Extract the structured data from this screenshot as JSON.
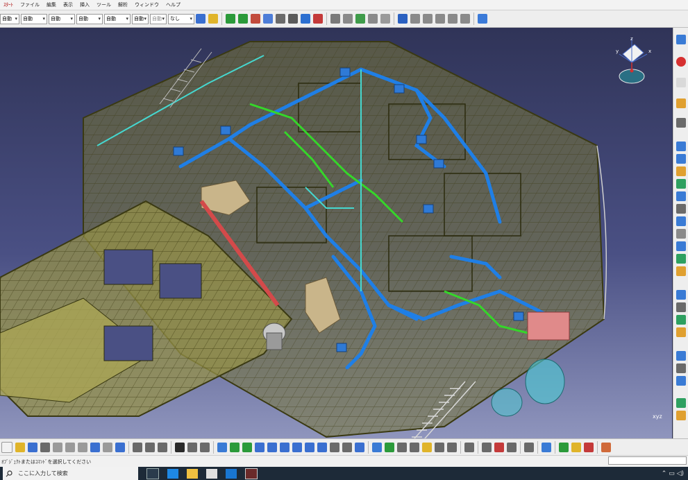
{
  "menubar": {
    "items": [
      "ｽﾀｰﾄ",
      "ファイル",
      "編集",
      "表示",
      "挿入",
      "ツール",
      "解析",
      "ウィンドウ",
      "ヘルプ"
    ]
  },
  "toolbar": {
    "selects": [
      "自動",
      "自動",
      "自動",
      "自動",
      "自動",
      "自動",
      "自動",
      "なし"
    ]
  },
  "compass": {
    "axis_x": "x",
    "axis_y": "y",
    "axis_z": "z"
  },
  "corner_axis": {
    "label": "xyz"
  },
  "status": {
    "prompt": "ｵﾌﾞｼﾞｪｸﾄまたはｺﾏﾝﾄﾞを選択してください"
  },
  "taskbar": {
    "search_placeholder": "ここに入力して検索"
  },
  "colors": {
    "structure": "#7c7a38",
    "pipe_blue": "#1f7fe6",
    "pipe_green": "#35d62a",
    "pipe_cyan": "#45d8d0",
    "duct_tan": "#c9b58a",
    "accent_red": "#d34a4a",
    "background": "#3a3f69"
  }
}
